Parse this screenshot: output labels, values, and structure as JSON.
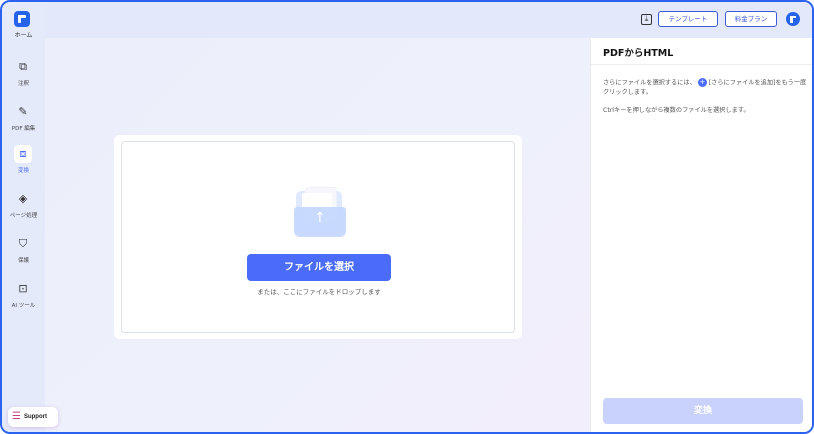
{
  "app": {
    "home_label": "ホーム",
    "accent_color": "#4b6cf8",
    "frame_color": "#2b63f0"
  },
  "sidebar": {
    "items": [
      {
        "label": "注釈",
        "icon": "annotate-icon"
      },
      {
        "label": "PDF 編集",
        "icon": "edit-pen-icon"
      },
      {
        "label": "変換",
        "icon": "convert-icon",
        "active": true
      },
      {
        "label": "ページ処理",
        "icon": "layers-icon"
      },
      {
        "label": "保護",
        "icon": "shield-icon"
      },
      {
        "label": "AI ツール",
        "icon": "ai-tools-icon"
      }
    ],
    "support_label": "Support"
  },
  "topbar": {
    "template_label": "テンプレート",
    "price_label": "料金プラン"
  },
  "main": {
    "select_button": "ファイルを選択",
    "drop_hint": "または、ここにファイルをドロップします"
  },
  "panel": {
    "title": "PDFからHTML",
    "hint1_before": "さらにファイルを選択するには、",
    "hint1_after": "[さらにファイルを追加]をもう一度クリックします。",
    "hint2": "Ctrlキーを押しながら複数のファイルを選択します。",
    "convert_button": "変換"
  }
}
